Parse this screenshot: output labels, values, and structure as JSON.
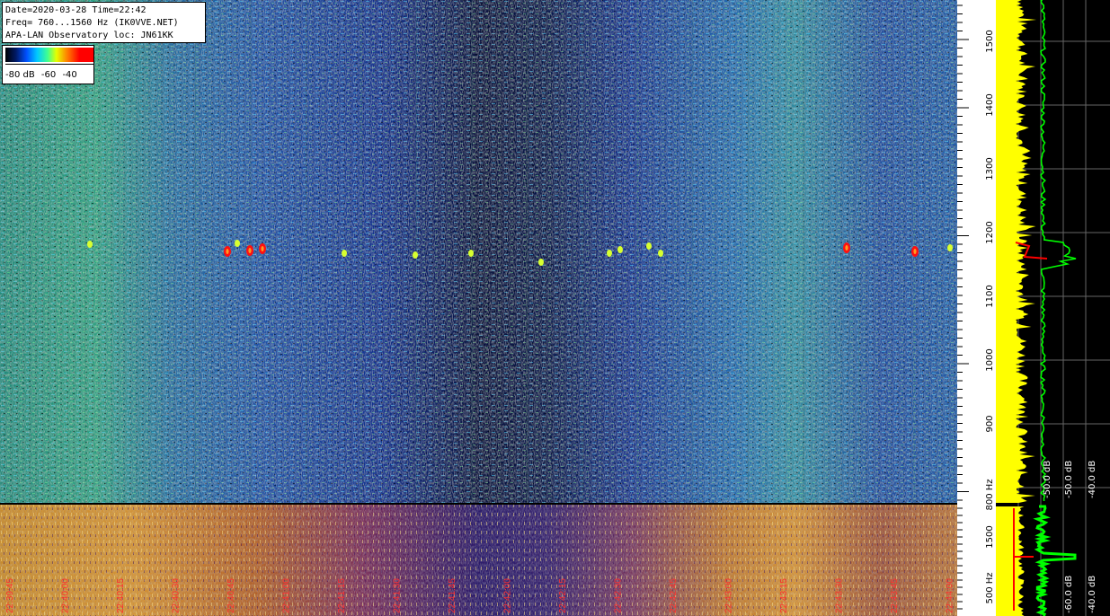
{
  "info": {
    "line1": "Date=2020-03-28 Time=22:42",
    "line2": "Freq= 760...1560 Hz (IK0VVE.NET)",
    "line3": "APA-LAN Observatory loc: JN61KK"
  },
  "legend": {
    "labels": [
      "-80 dB",
      "-60",
      "-40"
    ]
  },
  "top_axis": {
    "ticks": [
      "1500",
      "1400",
      "1300",
      "1200",
      "1100",
      "1000",
      "900",
      "800 Hz"
    ]
  },
  "bottom_axis": {
    "ticks": [
      "1500",
      "500 Hz"
    ]
  },
  "db_labels_top": [
    "-50.0 dB",
    "-40.0 dB"
  ],
  "db_labels_bottom": [
    "-60.0 dB",
    "-40.0 dB"
  ],
  "time_labels": [
    "22:39:45",
    "22:40:00",
    "22:40:15",
    "22:40:30",
    "22:40:45",
    "22:41:00",
    "22:41:15",
    "22:41:30",
    "22:41:45",
    "22:42:00",
    "22:42:15",
    "22:42:30",
    "22:42:45",
    "22:43:00",
    "22:43:15",
    "22:43:30",
    "22:43:45",
    "22:44:00"
  ],
  "colors": {
    "spectrum_fill": "#ffff00",
    "peak_line": "#00ff00",
    "signal_marker": "#ff0000",
    "time_label": "#ff3030"
  }
}
